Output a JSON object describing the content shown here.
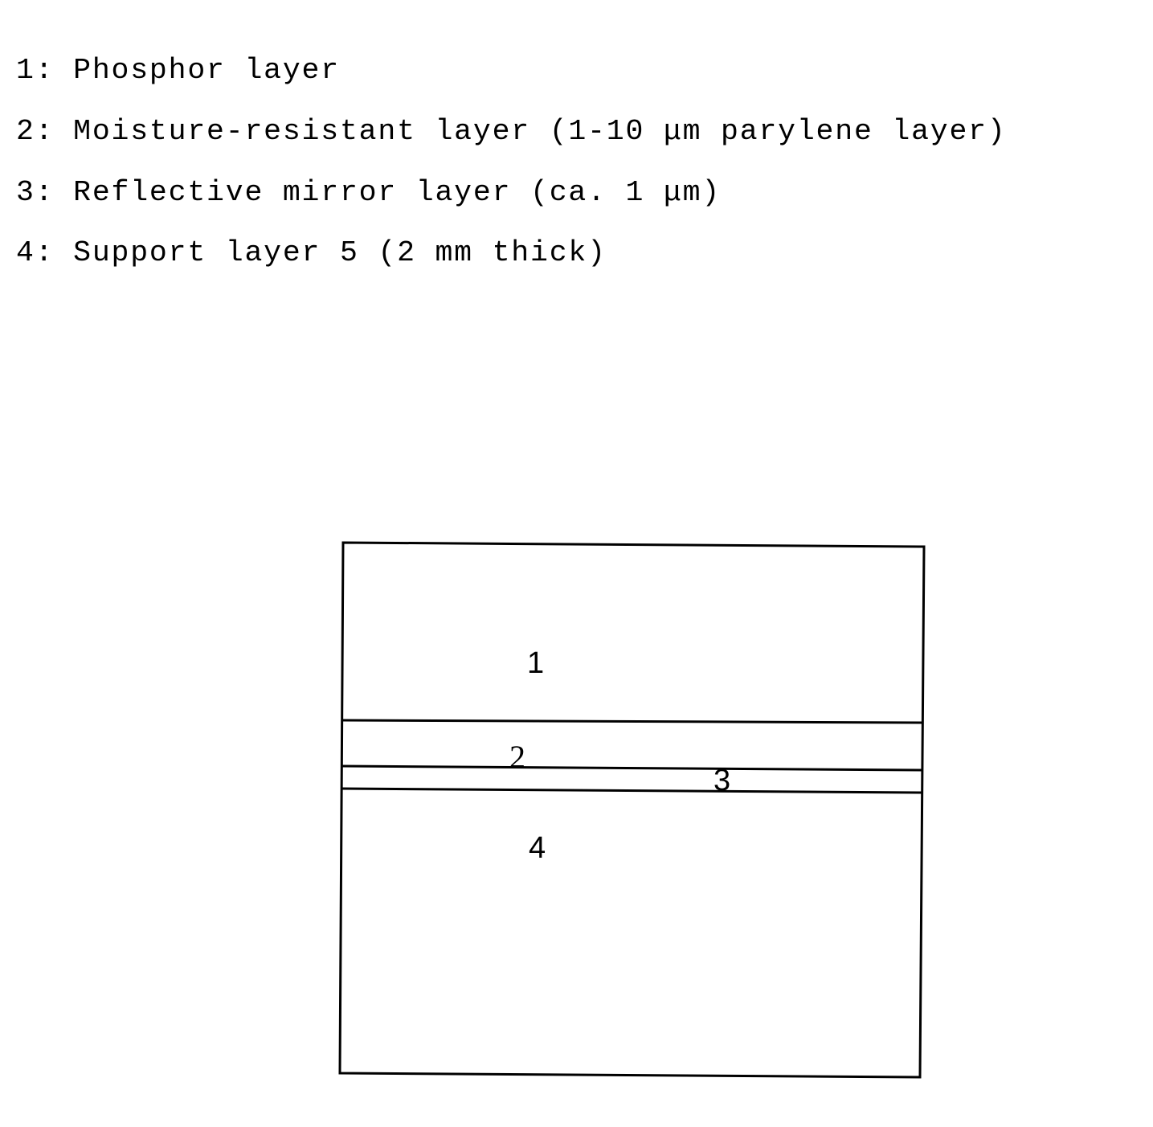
{
  "legend": {
    "items": [
      {
        "number": "1",
        "text": "1: Phosphor layer"
      },
      {
        "number": "2",
        "text": "2: Moisture-resistant layer (1-10 μm parylene layer)"
      },
      {
        "number": "3",
        "text": "3: Reflective mirror layer (ca. 1 μm)"
      },
      {
        "number": "4",
        "text": "4: Support layer 5 (2 mm thick)"
      }
    ]
  },
  "diagram": {
    "layers": [
      {
        "label": "1",
        "name": "Phosphor layer"
      },
      {
        "label": "2",
        "name": "Moisture-resistant layer"
      },
      {
        "label": "3",
        "name": "Reflective mirror layer"
      },
      {
        "label": "4",
        "name": "Support layer"
      }
    ],
    "stroke_color": "#000000",
    "background_color": "#ffffff"
  }
}
